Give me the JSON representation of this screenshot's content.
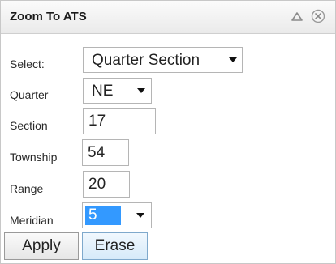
{
  "panel": {
    "title": "Zoom To ATS",
    "controls": {
      "collapse_icon": "triangle-up-icon",
      "close_icon": "circle-x-icon"
    }
  },
  "form": {
    "select": {
      "label": "Select:",
      "value": "Quarter Section"
    },
    "quarter": {
      "label": "Quarter",
      "value": "NE"
    },
    "section": {
      "label": "Section",
      "value": "17"
    },
    "township": {
      "label": "Township",
      "value": "54"
    },
    "range": {
      "label": "Range",
      "value": "20"
    },
    "meridian": {
      "label": "Meridian",
      "value": "5"
    }
  },
  "buttons": {
    "apply": "Apply",
    "erase": "Erase"
  },
  "colors": {
    "selection": "#3399ff",
    "erase_bg": "#d6eaf9",
    "erase_border": "#7fa9cc"
  }
}
